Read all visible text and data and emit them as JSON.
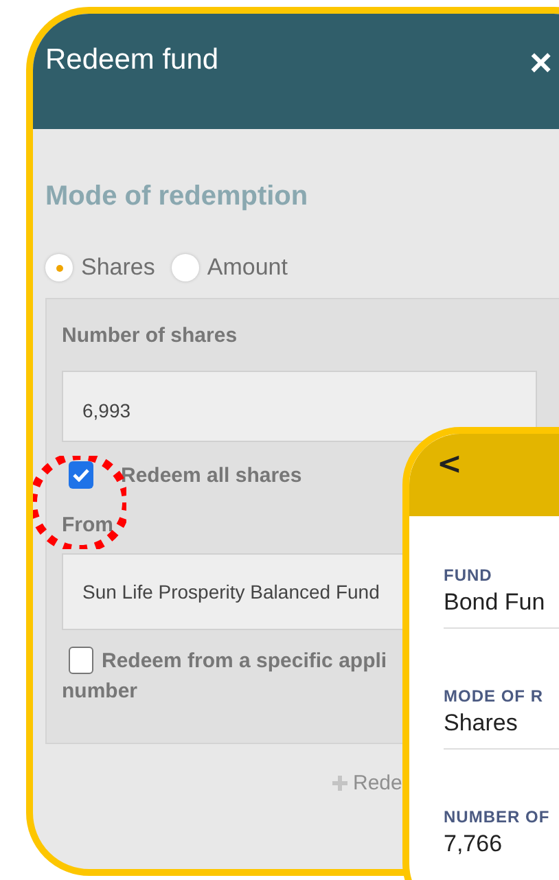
{
  "redeem_dialog": {
    "title": "Redeem fund",
    "close": "×",
    "mode_heading": "Mode of redemption",
    "modes": [
      {
        "label": "Shares",
        "selected": true
      },
      {
        "label": "Amount",
        "selected": false
      }
    ],
    "shares_label": "Number of shares",
    "shares_value": "6,993",
    "redeem_all": {
      "label": "Redeem all shares",
      "checked": true
    },
    "from_label": "From",
    "from_value": "Sun Life Prosperity Balanced Fund",
    "specific": {
      "label_line1": "Redeem from a specific appli",
      "label_line2": "number",
      "checked": false
    },
    "add_button": "Rede"
  },
  "summary_card": {
    "back": "<",
    "fields": [
      {
        "label": "FUND",
        "value": "Bond Fun"
      },
      {
        "label": "MODE OF R",
        "value": "Shares"
      },
      {
        "label": "NUMBER OF",
        "value": "7,766"
      }
    ]
  }
}
